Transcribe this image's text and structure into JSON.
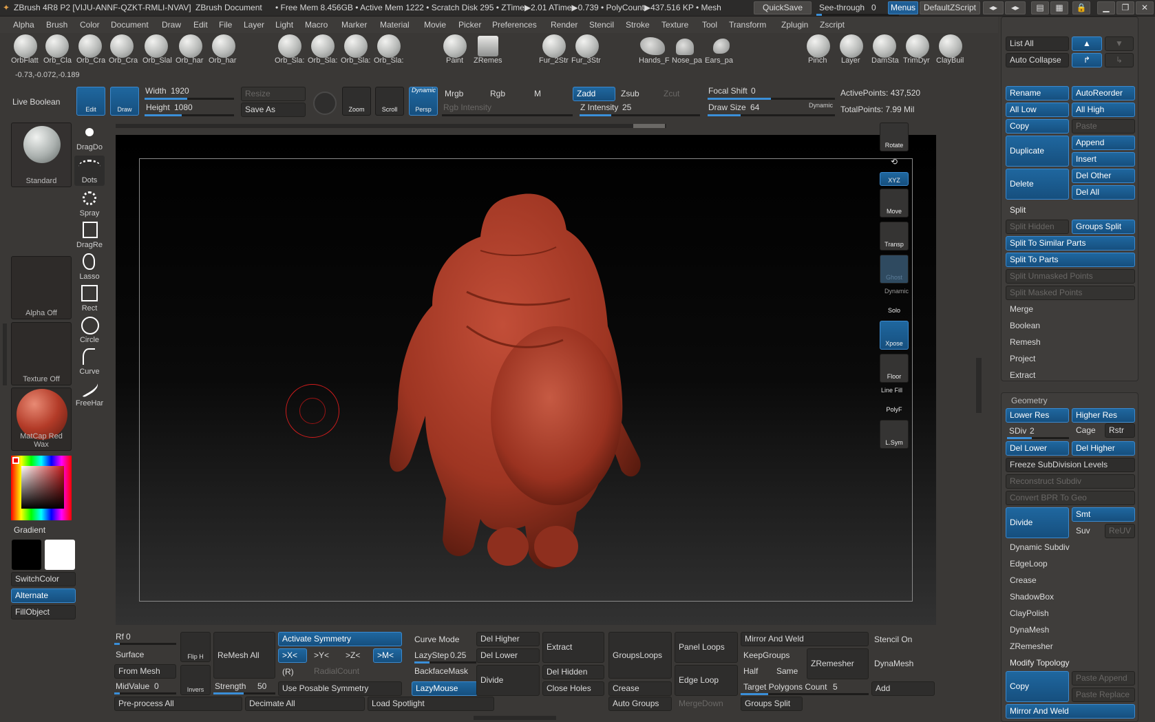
{
  "titlebar": {
    "app": "ZBrush 4R8 P2 [VIJU-ANNF-QZKT-RMLI-NVAV]",
    "doc": "ZBrush Document",
    "stats": "• Free Mem 8.456GB • Active Mem 1222 • Scratch Disk 295 • ZTime▶2.01 ATime▶0.739 • PolyCount▶437.516 KP • Mesh",
    "quicksave": "QuickSave",
    "seethrough": "See-through",
    "seethrough_val": "0",
    "menus": "Menus",
    "zscript": "DefaultZScript"
  },
  "menubar": [
    "Alpha",
    "Brush",
    "Color",
    "Document",
    "Draw",
    "Edit",
    "File",
    "Layer",
    "Light",
    "Macro",
    "Marker",
    "Material",
    "Movie",
    "Picker",
    "Preferences",
    "Render",
    "Stencil",
    "Stroke",
    "Texture",
    "Tool",
    "Transform",
    "Zplugin",
    "Zscript"
  ],
  "shelf": {
    "brushes": [
      "OrbFlatt",
      "Orb_Cla",
      "Orb_Cra",
      "Orb_Cra",
      "Orb_Slal",
      "Orb_har"
    ],
    "brushes2": [
      "Orb_Sla:",
      "Orb_Sla:",
      "Orb_Sla:",
      "Orb_Sla:"
    ],
    "paint": "Paint",
    "zremesh": "ZRemes",
    "fur": [
      "Fur_2Str",
      "Fur_3Str"
    ],
    "parts": [
      "Hands_F",
      "Nose_pa",
      "Ears_pa"
    ],
    "right": [
      "Pinch",
      "Layer",
      "DamSta",
      "TrimDyr",
      "ClayBuil"
    ]
  },
  "coords": "-0.73,-0.072,-0.189",
  "topbar": {
    "live_boolean": "Live Boolean",
    "edit": "Edit",
    "draw": "Draw",
    "width_label": "Width",
    "width_val": "1920",
    "height_label": "Height",
    "height_val": "1080",
    "resize": "Resize",
    "saveas": "Save As",
    "zoom": "Zoom",
    "scroll": "Scroll",
    "persp": "Persp",
    "dynamic": "Dynamic",
    "mrgb": "Mrgb",
    "rgb": "Rgb",
    "m": "M",
    "zadd": "Zadd",
    "zsub": "Zsub",
    "zcut": "Zcut",
    "rgb_intensity": "Rgb Intensity",
    "z_intensity_label": "Z Intensity",
    "z_intensity_val": "25",
    "focal_label": "Focal Shift",
    "focal_val": "0",
    "drawsize_label": "Draw Size",
    "drawsize_val": "64",
    "dynamic2": "Dynamic",
    "active_points": "ActivePoints: 437,520",
    "total_points": "TotalPoints: 7.99 Mil"
  },
  "left": {
    "brush": "Standard",
    "alpha": "Alpha Off",
    "texture": "Texture Off",
    "material": "MatCap Red Wax",
    "gradient": "Gradient",
    "switchcolor": "SwitchColor",
    "alternate": "Alternate",
    "fillobject": "FillObject",
    "strokes": [
      "DragDo",
      "Dots",
      "Spray",
      "DragRe",
      "Lasso",
      "Rect",
      "Circle",
      "Curve",
      "FreeHar"
    ]
  },
  "righttools": [
    "Rotate",
    "XYZ",
    "Move",
    "Transp",
    "Ghost",
    "Solo",
    "Xpose",
    "Floor",
    "PolyF",
    "L.Sym"
  ],
  "righttools_extra": {
    "dynamic": "Dynamic",
    "linefill": "Line Fill"
  },
  "subtool": {
    "list_all": "List All",
    "auto_collapse": "Auto Collapse",
    "rename": "Rename",
    "autoreorder": "AutoReorder",
    "alllow": "All Low",
    "allhigh": "All High",
    "copy": "Copy",
    "paste": "Paste",
    "duplicate": "Duplicate",
    "append": "Append",
    "insert": "Insert",
    "delete": "Delete",
    "delother": "Del Other",
    "delall": "Del All",
    "split": "Split",
    "split_hidden": "Split Hidden",
    "groups_split": "Groups Split",
    "split_similar": "Split To Similar Parts",
    "split_parts": "Split To Parts",
    "split_unmasked": "Split Unmasked Points",
    "split_masked": "Split Masked Points",
    "merge": "Merge",
    "boolean": "Boolean",
    "remesh": "Remesh",
    "project": "Project",
    "extract": "Extract"
  },
  "geometry": {
    "title": "Geometry",
    "lower": "Lower Res",
    "higher": "Higher Res",
    "sdiv_label": "SDiv",
    "sdiv_val": "2",
    "cage": "Cage",
    "rstr": "Rstr",
    "dellower": "Del Lower",
    "delhigher": "Del Higher",
    "freeze": "Freeze SubDivision Levels",
    "reconstruct": "Reconstruct Subdiv",
    "convert": "Convert BPR To Geo",
    "divide": "Divide",
    "smt": "Smt",
    "suv": "Suv",
    "reuv": "ReUV",
    "items": [
      "Dynamic Subdiv",
      "EdgeLoop",
      "Crease",
      "ShadowBox",
      "ClayPolish",
      "DynaMesh",
      "ZRemesher"
    ],
    "modify": "Modify Topology",
    "copy": "Copy",
    "paste_append": "Paste Append",
    "paste_replace": "Paste Replace",
    "mirror_weld": "Mirror And Weld"
  },
  "bottom": {
    "rf_label": "Rf",
    "rf_val": "0",
    "surface": "Surface",
    "frommesh": "From Mesh",
    "midvalue_label": "MidValue",
    "midvalue_val": "0",
    "preprocess": "Pre-process All",
    "fliph": "Flip H",
    "invers": "Invers",
    "remeshall": "ReMesh All",
    "strength_label": "Strength",
    "strength_val": "50",
    "decimate": "Decimate All",
    "activate_sym": "Activate Symmetry",
    "x": ">X<",
    "y": ">Y<",
    "z": ">Z<",
    "m": ">M<",
    "r": "(R)",
    "radialcount": "RadialCount",
    "poseable": "Use Posable Symmetry",
    "loadspot": "Load Spotlight",
    "curvemode": "Curve Mode",
    "lazystep_label": "LazyStep",
    "lazystep_val": "0.25",
    "backface": "BackfaceMask",
    "lazymouse": "LazyMouse",
    "delhigher": "Del Higher",
    "dellower": "Del Lower",
    "divide": "Divide",
    "extract": "Extract",
    "delhidden": "Del Hidden",
    "closeholes": "Close Holes",
    "groupsloops": "GroupsLoops",
    "crease": "Crease",
    "autogroups": "Auto Groups",
    "panelloops": "Panel Loops",
    "edgeloop": "Edge Loop",
    "mergedown": "MergeDown",
    "mirrorweld": "Mirror And Weld",
    "keepgroups": "KeepGroups",
    "half": "Half",
    "same": "Same",
    "zremesher": "ZRemesher",
    "targetpoly_label": "Target Polygons Count",
    "targetpoly_val": "5",
    "groupssplit": "Groups Split",
    "stencilon": "Stencil On",
    "dynamesh": "DynaMesh",
    "add": "Add"
  },
  "colors": {
    "accent": "#1f679f",
    "model": "#a83a2a",
    "bg": "#3a3836"
  }
}
